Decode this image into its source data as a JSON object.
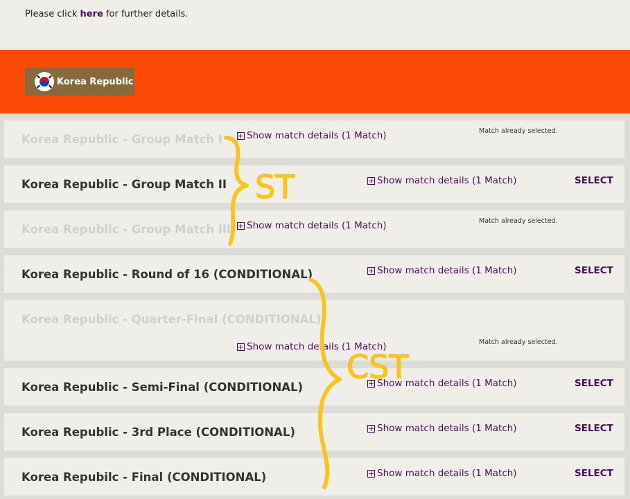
{
  "notice": {
    "prefix": "Please click ",
    "link": "here",
    "suffix": " for further details."
  },
  "team": {
    "name": "Korea Republic"
  },
  "matches": [
    {
      "title": "Korea Republic - Group Match I",
      "details": "Show match details (1 Match)",
      "status": "Match already selected.",
      "available": false
    },
    {
      "title": "Korea Republic - Group Match II",
      "details": "Show match details (1 Match)",
      "action": "SELECT",
      "available": true
    },
    {
      "title": "Korea Republic - Group Match III",
      "details": "Show match details (1 Match)",
      "status": "Match already selected.",
      "available": false
    },
    {
      "title": "Korea Republic - Round of 16 (CONDITIONAL)",
      "details": "Show match details (1 Match)",
      "action": "SELECT",
      "available": true
    },
    {
      "title": "Korea Republic - Quarter-Final (CONDITIONAL)",
      "details": "Show match details (1 Match)",
      "status": "Match already selected.",
      "available": false
    },
    {
      "title": "Korea Republic - Semi-Final (CONDITIONAL)",
      "details": "Show match details (1 Match)",
      "action": "SELECT",
      "available": true
    },
    {
      "title": "Korea Republic - 3rd Place (CONDITIONAL)",
      "details": "Show match details (1 Match)",
      "action": "SELECT",
      "available": true
    },
    {
      "title": "Korea Repubilc - Final (CONDITIONAL)",
      "details": "Show match details (1 Match)",
      "action": "SELECT",
      "available": true
    }
  ],
  "annotations": {
    "group_label": "ST",
    "knockout_label": "CST",
    "color": "#f7c520"
  },
  "colors": {
    "banner": "#fa4a05",
    "badge": "#856b3b",
    "accent": "#4b0f5a"
  }
}
